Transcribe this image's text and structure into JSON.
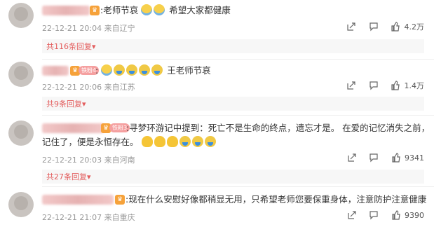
{
  "comments": [
    {
      "text_prefix": ":老师节哀",
      "text_suffix": "希望大家都健康",
      "date": "22-12-21 20:04",
      "location": "来自辽宁",
      "likes": "4.2万",
      "reply_label": "共116条回复"
    },
    {
      "fan_badge": "铁粉4",
      "text_prefix": ":",
      "text_suffix": "王老师节哀",
      "date": "22-12-21 20:06",
      "location": "来自江苏",
      "likes": "1.4万",
      "reply_label": "共9条回复"
    },
    {
      "fan_badge": "铁粉3",
      "text_line1": ":寻梦环游记中提到：死亡不是生命的终点，遗忘才是。  在爱的记忆消失之前，",
      "text_line2": "记住了，便是永恒存在。",
      "date": "22-12-21 20:03",
      "location": "来自河南",
      "likes": "9341",
      "reply_label": "共27条回复"
    },
    {
      "text_prefix": ":现在什么安慰好像都稍显无用，只希望老师您要保重身体，注意防护注意健康",
      "date": "22-12-21 21:07",
      "location": "来自重庆",
      "likes": "9390"
    }
  ],
  "icons": {
    "share": "share-icon",
    "comment": "comment-icon",
    "like": "thumb-up-icon",
    "expand": "caret-down-icon"
  },
  "colors": {
    "accent": "#e35c5c",
    "meta": "#999999"
  }
}
